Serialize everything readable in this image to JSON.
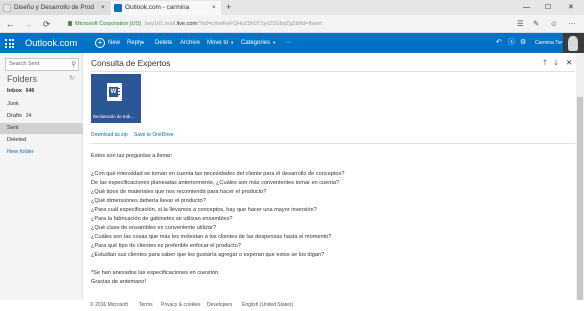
{
  "browser": {
    "tabs": [
      {
        "title": "Diseño y Desarrollo de Prod",
        "close": "×"
      },
      {
        "title": "Outlook.com - carmina",
        "close": "×"
      }
    ],
    "new_tab": "+",
    "window_controls": [
      "—",
      "☐",
      "✕"
    ],
    "url": {
      "company": "Microsoft Corporation [US]",
      "host_prefix": "bay161.mail.",
      "host_main": "live.com",
      "path": "/?tid=cmwKeFQHoZ5h0T1yxZ5UbdZg2&fid=flsent"
    },
    "nav_icons": [
      "←",
      "→",
      "⟳"
    ],
    "right_icons": [
      "☰",
      "✎",
      "☺",
      "⋯"
    ]
  },
  "outlook_bar": {
    "brand": "Outlook.com",
    "commands": {
      "new": "New",
      "reply": "Reply",
      "delete": "Delete",
      "archive": "Archive",
      "move_to": "Move to",
      "categories": "Categories",
      "more": "⋯"
    },
    "user_name": "Carmina Tor"
  },
  "sidebar": {
    "search_placeholder": "Search Sent",
    "folders_title": "Folders",
    "refresh_icon": "↻",
    "items": [
      {
        "label": "Inbox",
        "count": "646"
      },
      {
        "label": "Junk",
        "count": ""
      },
      {
        "label": "Drafts",
        "count": "24"
      },
      {
        "label": "Sent",
        "count": ""
      },
      {
        "label": "Deleted",
        "count": ""
      }
    ],
    "new_folder": "New folder"
  },
  "message": {
    "subject": "Consulta de Expertos",
    "attachment": {
      "name": "Declaración de trab…",
      "icon_letter": "W",
      "download_zip": "Download as zip",
      "save_onedrive": "Save to OneDrive"
    },
    "body": [
      "Estos son las preguntas a llenar:",
      "",
      "¿Con qué intensidad se toman en cuenta las necesidades del cliente para el desarrollo de conceptos?",
      "De las especificaciones planeadas anteriormente, ¿Cuáles son más convenientes tomar en cuenta?",
      "¿Qué tipos de materiales que nos recomienda para hacer el producto?",
      "¿Qué dimensiones debería llevar el producto?",
      "¿Para cuál especificación, si la llevamos a conceptos, hay que hacer una mayor inversión?",
      "¿Para la fabricación de gabinetes se utilizan ensambles?",
      "¿Qué clase de ensambles es conveniente utilizar?",
      "¿Cuáles son las cosas que más les molestan a los clientes de las despensas hasta el momento?",
      "¿Para qué tipo de clientes es preferible enfocar el producto?",
      "¿Estudian sus clientes para saber que les gustaría agregar o esperan que estos se los digan?",
      "",
      "*Se han anexados las especificaciones en cuestión.",
      "Gracias de antemano!"
    ]
  },
  "footer": {
    "copyright": "© 2016 Microsoft",
    "links": [
      "Terms",
      "Privacy & cookies",
      "Developers",
      "English (United States)"
    ]
  },
  "colors": {
    "outlook_blue": "#0072c6",
    "word_blue": "#2b5797",
    "https_green": "#2b8a2b"
  }
}
